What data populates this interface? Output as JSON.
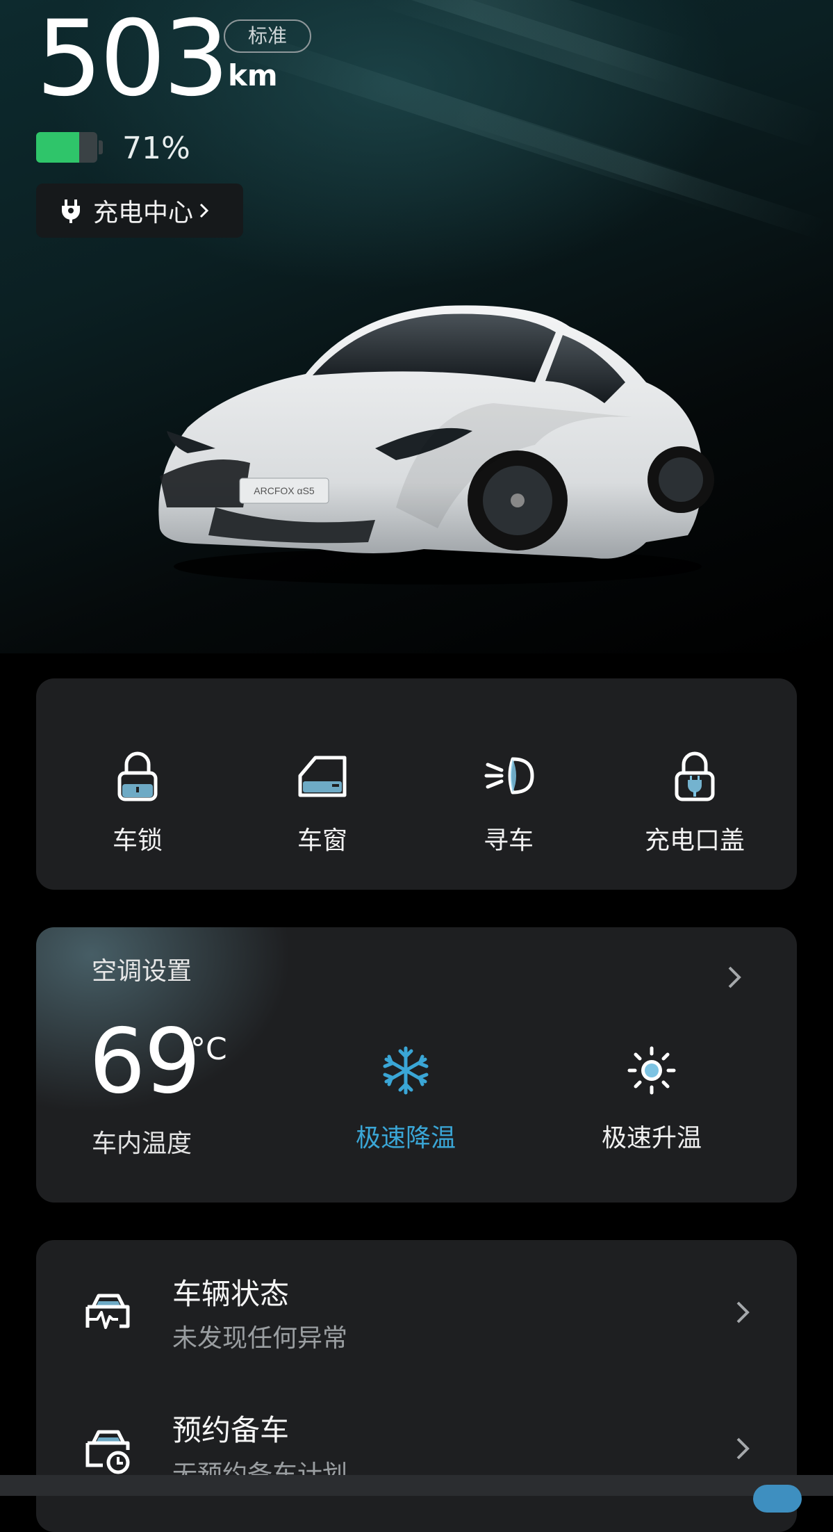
{
  "range": {
    "value": "503",
    "unit": "km",
    "mode": "标准"
  },
  "battery": {
    "percent_text": "71%",
    "level": 0.71,
    "fill_color": "#2fc56a"
  },
  "charge_center": {
    "label": "充电中心",
    "icon": "plug-icon"
  },
  "car_image": {
    "badge_text": "ARCFOX αS5"
  },
  "controls": [
    {
      "label": "车锁",
      "icon": "lock-icon"
    },
    {
      "label": "车窗",
      "icon": "window-icon"
    },
    {
      "label": "寻车",
      "icon": "find-car-headlight-icon"
    },
    {
      "label": "充电口盖",
      "icon": "charge-port-lock-icon"
    }
  ],
  "ac": {
    "title": "空调设置",
    "temperature": "69",
    "temperature_unit": "°C",
    "temperature_label": "车内温度",
    "cool": {
      "label": "极速降温",
      "icon": "snowflake-icon",
      "color": "#3aa6d6"
    },
    "heat": {
      "label": "极速升温",
      "icon": "sun-icon"
    }
  },
  "status_list": [
    {
      "title": "车辆状态",
      "subtitle": "未发现任何异常",
      "icon": "vehicle-status-icon"
    },
    {
      "title": "预约备车",
      "subtitle": "无预约备车计划",
      "icon": "scheduled-prep-icon"
    }
  ],
  "colors": {
    "accent": "#3aa6d6",
    "card_bg": "#1e1f21"
  }
}
